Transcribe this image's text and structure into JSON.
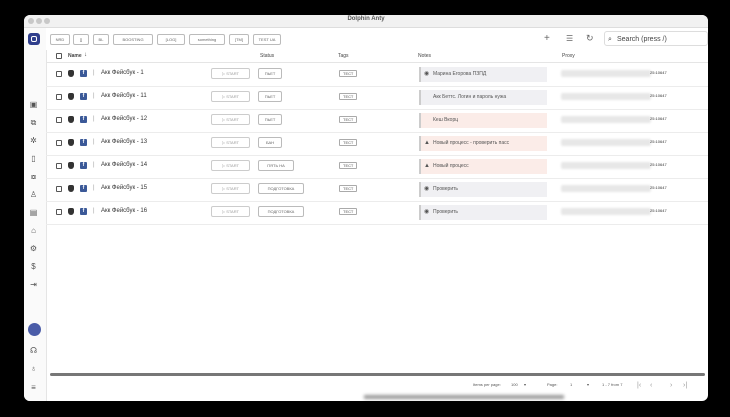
{
  "window": {
    "title": "Dolphin Anty"
  },
  "toolbar": {
    "filters": [
      "NRD",
      "[]",
      "BL",
      "BOOSTING",
      "[LOG]",
      "something",
      "[TM]",
      "TEST UA"
    ],
    "search_placeholder": "Search (press /)"
  },
  "table": {
    "headers": {
      "name": "Name",
      "status": "Status",
      "tags": "Tags",
      "notes": "Notes",
      "proxy": "Proxy"
    },
    "rows": [
      {
        "name": "Акк Фейсбук - 1",
        "start": "START",
        "status": "ПЬЕТ",
        "tag": "ТЕСТ",
        "note": "Марина Егорова ПЗПД",
        "note_icon": "globe",
        "proxy_suffix": "25:10647",
        "highlight": "none"
      },
      {
        "name": "Акк Фейсбук - 11",
        "start": "START",
        "status": "ПЬЕТ",
        "tag": "ТЕСТ",
        "note": "Акк Беттс. Логин и пароль нужа",
        "note_icon": "",
        "proxy_suffix": "25:10647",
        "highlight": "none"
      },
      {
        "name": "Акк Фейсбук - 12",
        "start": "START",
        "status": "ПЬЕТ",
        "tag": "ТЕСТ",
        "note": "Кеш Вкорц",
        "note_icon": "",
        "proxy_suffix": "25:10647",
        "highlight": "pink"
      },
      {
        "name": "Акк Фейсбук - 13",
        "start": "START",
        "status": "БАН",
        "tag": "ТЕСТ",
        "note": "Новый процесс - проверить пасс",
        "note_icon": "warning",
        "proxy_suffix": "25:10647",
        "highlight": "pink"
      },
      {
        "name": "Акк Фейсбук - 14",
        "start": "START",
        "status": "ПЯТЬ НА",
        "tag": "ТЕСТ",
        "note": "Новый процесс",
        "note_icon": "warning",
        "proxy_suffix": "25:10647",
        "highlight": "pink"
      },
      {
        "name": "Акк Фейсбук - 15",
        "start": "START",
        "status": "ПОДГОТОВКА",
        "tag": "ТЕСТ",
        "note": "Проверить",
        "note_icon": "globe",
        "proxy_suffix": "25:10647",
        "highlight": "none"
      },
      {
        "name": "Акк Фейсбук - 16",
        "start": "START",
        "status": "ПОДГОТОВКА",
        "tag": "ТЕСТ",
        "note": "Проверить",
        "note_icon": "globe",
        "proxy_suffix": "25:10647",
        "highlight": "none"
      }
    ]
  },
  "footer": {
    "items_per_page_label": "Items per page:",
    "items_per_page_value": "100",
    "page_label": "Page:",
    "page_value": "1",
    "range": "1 - 7 from 7"
  },
  "colors": {
    "accent": "#2f3e8c",
    "facebook": "#3b5998",
    "pink_note": "#fbece8"
  }
}
